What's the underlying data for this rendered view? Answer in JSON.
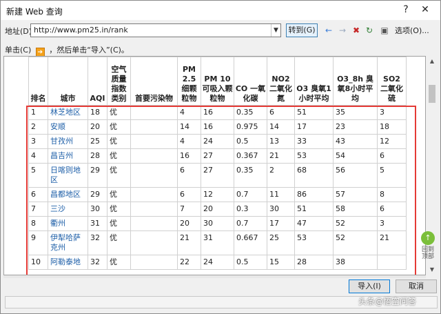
{
  "window": {
    "title": "新建 Web 查询",
    "help": "?",
    "close": "✕"
  },
  "address": {
    "label": "地址(D):",
    "url": "http://www.pm25.in/rank",
    "go_label": "转到(G)",
    "options_label": "选项(O)..."
  },
  "hint": {
    "pre": "单击(C)",
    "post": "，然后单击“导入”(C)。"
  },
  "table": {
    "headers": [
      "排名",
      "城市",
      "AQI",
      "空气质量指数类别",
      "首要污染物",
      "PM 2.5 细颗粒物",
      "PM 10 可吸入颗粒物",
      "CO 一氧化碳",
      "NO2 二氧化氮",
      "O3 臭氧1小时平均",
      "O3_8h 臭氧8小时平均",
      "SO2 二氧化硫"
    ],
    "rows": [
      [
        "1",
        "林芝地区",
        "18",
        "优",
        "",
        "4",
        "16",
        "0.35",
        "6",
        "51",
        "35",
        "3"
      ],
      [
        "2",
        "安顺",
        "20",
        "优",
        "",
        "14",
        "16",
        "0.975",
        "14",
        "17",
        "23",
        "18"
      ],
      [
        "3",
        "甘孜州",
        "25",
        "优",
        "",
        "4",
        "24",
        "0.5",
        "13",
        "33",
        "43",
        "12"
      ],
      [
        "4",
        "昌吉州",
        "28",
        "优",
        "",
        "16",
        "27",
        "0.367",
        "21",
        "53",
        "54",
        "6"
      ],
      [
        "5",
        "日喀则地区",
        "29",
        "优",
        "",
        "6",
        "27",
        "0.35",
        "2",
        "68",
        "56",
        "5"
      ],
      [
        "6",
        "昌都地区",
        "29",
        "优",
        "",
        "6",
        "12",
        "0.7",
        "11",
        "86",
        "57",
        "8"
      ],
      [
        "7",
        "三沙",
        "30",
        "优",
        "",
        "7",
        "20",
        "0.3",
        "30",
        "51",
        "58",
        "6"
      ],
      [
        "8",
        "衢州",
        "31",
        "优",
        "",
        "20",
        "30",
        "0.7",
        "17",
        "47",
        "52",
        "3"
      ],
      [
        "9",
        "伊犁哈萨克州",
        "32",
        "优",
        "",
        "21",
        "31",
        "0.667",
        "25",
        "53",
        "52",
        "21"
      ],
      [
        "10",
        "阿勒泰地",
        "32",
        "优",
        "",
        "22",
        "24",
        "0.5",
        "15",
        "28",
        "38",
        ""
      ]
    ]
  },
  "side_badge": {
    "text": "回到顶部"
  },
  "buttons": {
    "import": "导入(I)",
    "cancel": "取消"
  },
  "watermark": "头条@悟空问答",
  "colors": {
    "link": "#1e5fa8",
    "highlight": "#e53935",
    "arrow": "#f4a21c"
  }
}
